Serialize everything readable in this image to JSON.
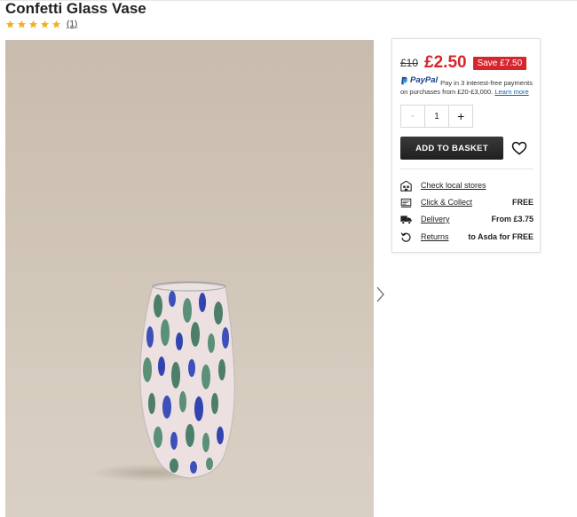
{
  "product": {
    "title": "Confetti Glass Vase",
    "rating_stars": 5,
    "review_count": "(1)"
  },
  "pricing": {
    "old_price": "£10",
    "new_price": "£2.50",
    "save_label": "Save £7.50"
  },
  "paypal": {
    "brand": "PayPal",
    "text": "Pay in 3 interest-free payments on purchases from £20-£3,000.",
    "learn_more": "Learn more"
  },
  "quantity": {
    "minus": "-",
    "value": "1",
    "plus": "+"
  },
  "actions": {
    "add_to_basket": "ADD TO BASKET"
  },
  "fulfilment": [
    {
      "icon": "store-icon",
      "label": "Check local stores",
      "value": ""
    },
    {
      "icon": "click-collect-icon",
      "label": "Click & Collect",
      "value": "FREE"
    },
    {
      "icon": "delivery-truck-icon",
      "label": "Delivery",
      "value": "From £3.75"
    },
    {
      "icon": "returns-icon",
      "label": "Returns",
      "value": "to Asda for FREE"
    }
  ],
  "colors": {
    "price_red": "#d6252d",
    "star_gold": "#f2b01e",
    "button_dark": "#222222",
    "link_blue": "#1a5fb4"
  }
}
